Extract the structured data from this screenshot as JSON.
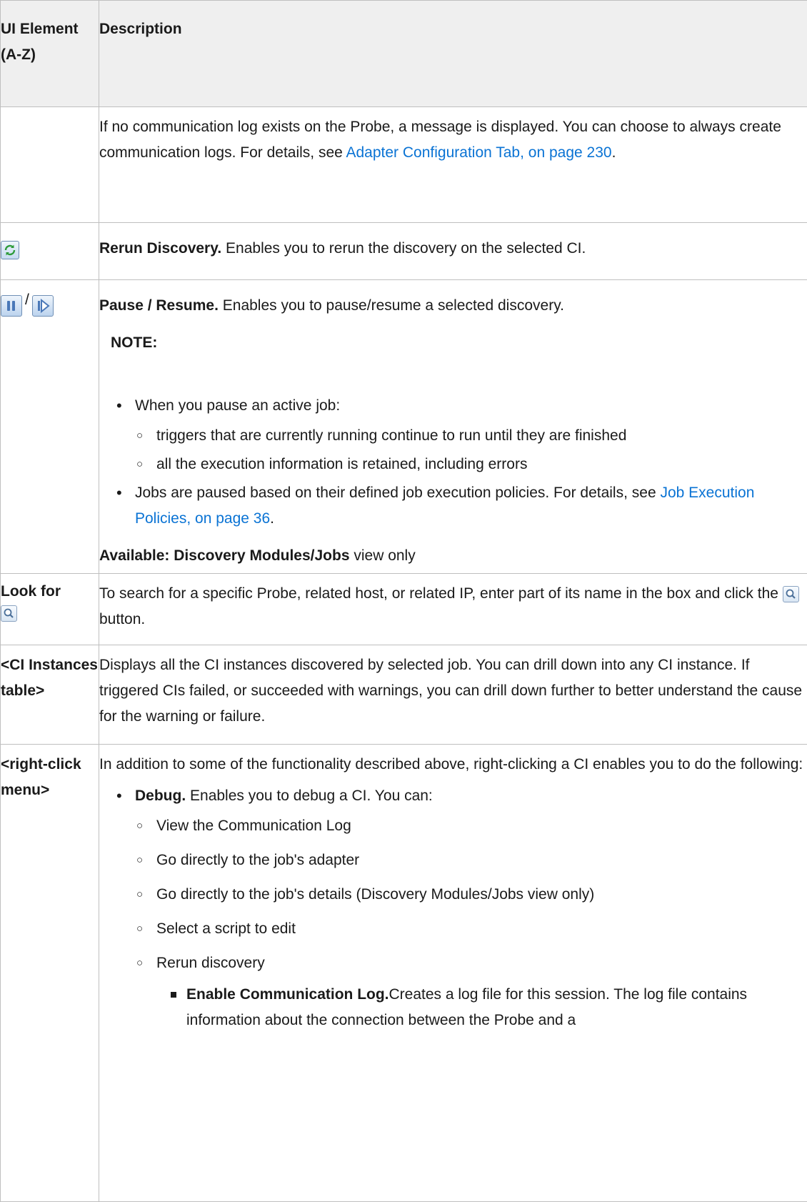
{
  "header": {
    "col1": "UI Element (A-Z)",
    "col2": "Description"
  },
  "row_comm_log": {
    "text_before": "If no communication log exists on the Probe, a message is displayed. You can choose to always create communication logs. For details, see ",
    "link": "Adapter Configuration Tab, on page 230",
    "text_after": "."
  },
  "row_rerun": {
    "icon": "rerun-discovery-icon",
    "title": "Rerun Discovery.",
    "text": " Enables you to rerun the discovery on the selected CI."
  },
  "row_pause": {
    "separator": "/",
    "title": "Pause / Resume.",
    "text": " Enables you to pause/resume a selected discovery.",
    "note_label": "NOTE:",
    "bullet1": "When you pause an active job:",
    "sub1": "triggers that are currently running continue to run until they are finished",
    "sub2": "all the execution information is retained, including errors",
    "bullet2_before": "Jobs are paused based on their defined job execution policies. For details, see ",
    "bullet2_link": "Job Execution Policies, on page 36",
    "bullet2_after": ".",
    "available_label": "Available: Discovery Modules/Jobs",
    "available_rest": " view only"
  },
  "row_lookfor": {
    "label": "Look for",
    "text_before": "To search for a specific Probe, related host, or related IP, enter part of its name in the box and click the ",
    "text_after": " button."
  },
  "row_ci_table": {
    "label": "<CI Instances table>",
    "text": "Displays all the CI instances discovered by selected job. You can drill down into any CI instance. If triggered CIs failed, or succeeded with warnings, you can drill down further to better understand the cause for the warning or failure."
  },
  "row_rightclick": {
    "label": "<right-click menu>",
    "intro": "In addition to some of the functionality described above, right-clicking a CI enables you to do the following:",
    "debug_title": "Debug.",
    "debug_text": " Enables you to debug a CI. You can:",
    "items": [
      "View the Communication Log",
      "Go directly to the job's adapter",
      "Go directly to the job's details (Discovery Modules/Jobs view only)",
      "Select a script to edit",
      "Rerun discovery"
    ],
    "enable_title": "Enable Communication Log.",
    "enable_text": "Creates a log file for this session. The log file contains information about the connection between the Probe and a"
  }
}
